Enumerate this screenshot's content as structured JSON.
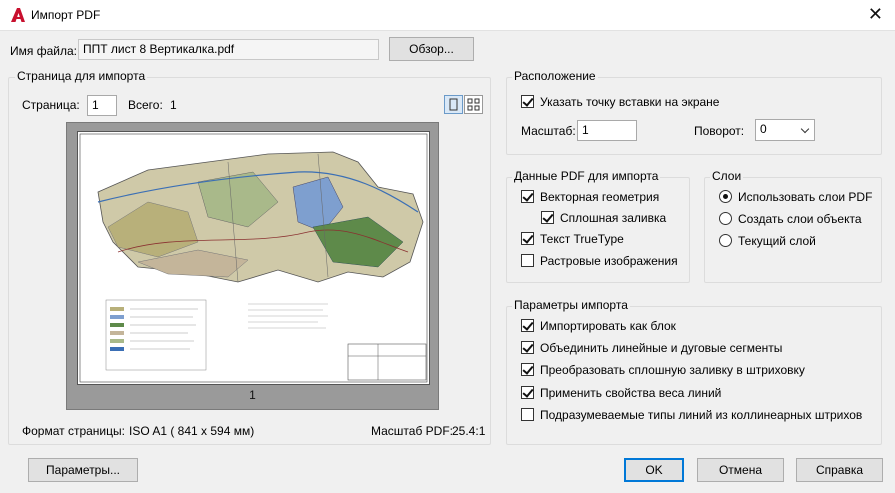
{
  "window": {
    "title": "Импорт PDF",
    "close_glyph": "✕"
  },
  "file": {
    "label": "Имя файла:",
    "value": "ППТ лист 8 Вертикалка.pdf",
    "browse_button": "Обзор..."
  },
  "page_section": {
    "title": "Страница для импорта",
    "page_label": "Страница:",
    "page_value": "1",
    "total_label": "Всего:",
    "total_value": "1",
    "preview_page_number": "1",
    "format_label": "Формат страницы:",
    "format_value": "ISO A1 ( 841 x  594 мм)",
    "scale_label": "Масштаб PDF:",
    "scale_value": "25.4:1"
  },
  "location": {
    "title": "Расположение",
    "specify_on_screen": {
      "label": "Указать точку вставки на экране",
      "checked": true
    },
    "scale_label": "Масштаб:",
    "scale_value": "1",
    "rotation_label": "Поворот:",
    "rotation_value": "0"
  },
  "pdf_data": {
    "title": "Данные PDF для импорта",
    "items": [
      {
        "label": "Векторная геометрия",
        "checked": true
      },
      {
        "label": "Сплошная заливка",
        "checked": true
      },
      {
        "label": "Текст TrueType",
        "checked": true
      },
      {
        "label": "Растровые изображения",
        "checked": false
      }
    ]
  },
  "layers": {
    "title": "Слои",
    "options": [
      {
        "label": "Использовать слои PDF",
        "selected": true
      },
      {
        "label": "Создать слои объекта",
        "selected": false
      },
      {
        "label": "Текущий слой",
        "selected": false
      }
    ]
  },
  "import_options": {
    "title": "Параметры импорта",
    "items": [
      {
        "label": "Импортировать как блок",
        "checked": true
      },
      {
        "label": "Объединить линейные и дуговые сегменты",
        "checked": true
      },
      {
        "label": "Преобразовать сплошную заливку в штриховку",
        "checked": true
      },
      {
        "label": "Применить свойства веса линий",
        "checked": true
      },
      {
        "label": "Подразумеваемые типы линий из коллинеарных штрихов",
        "checked": false
      }
    ]
  },
  "buttons": {
    "settings": "Параметры...",
    "ok": "OK",
    "cancel": "Отмена",
    "help": "Справка"
  },
  "icons": {
    "app": "autocad-a-icon",
    "single_page_view": "single-page-icon",
    "grid_view": "grid-view-icon"
  },
  "colors": {
    "app_icon": "#c8102e",
    "default_button_border": "#0078d7"
  }
}
